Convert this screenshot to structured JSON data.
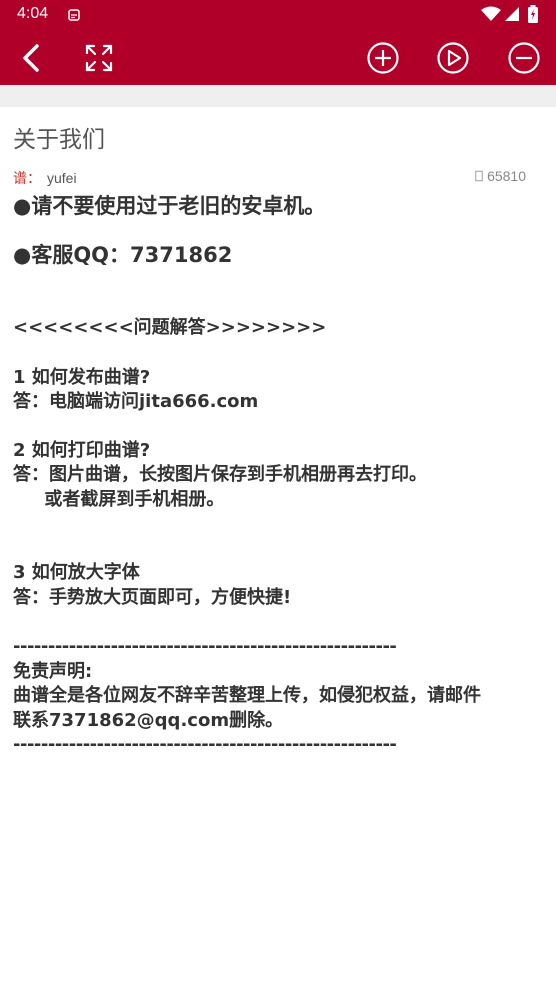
{
  "status": {
    "time": "4:04",
    "icons": [
      "notification-icon",
      "wifi-icon",
      "signal-icon",
      "battery-icon"
    ]
  },
  "toolbar": {
    "icons": [
      "back-icon",
      "fullscreen-icon",
      "zoom-in-icon",
      "play-icon",
      "zoom-out-icon"
    ],
    "accent": "#B0002A"
  },
  "article": {
    "title": "关于我们",
    "label": "谱：",
    "author": "yufei",
    "views": "65810"
  },
  "lines": [
    "●请不要使用过于老旧的安卓机。",
    "●客服QQ：7371862",
    "<<<<<<<<问题解答>>>>>>>>",
    "1 如何发布曲谱?",
    "答：电脑端访问jita666.com",
    "2 如何打印曲谱?",
    "答：图片曲谱，长按图片保存到手机相册再去打印。",
    "     或者截屏到手机相册。",
    "3 如何放大字体",
    "答：手势放大页面即可，方便快捷!",
    "-------------------------------------------------------",
    "免责声明:",
    "曲谱全是各位网友不辞辛苦整理上传，如侵犯权益，请邮件",
    "联系7371862@qq.com删除。",
    "-------------------------------------------------------"
  ]
}
